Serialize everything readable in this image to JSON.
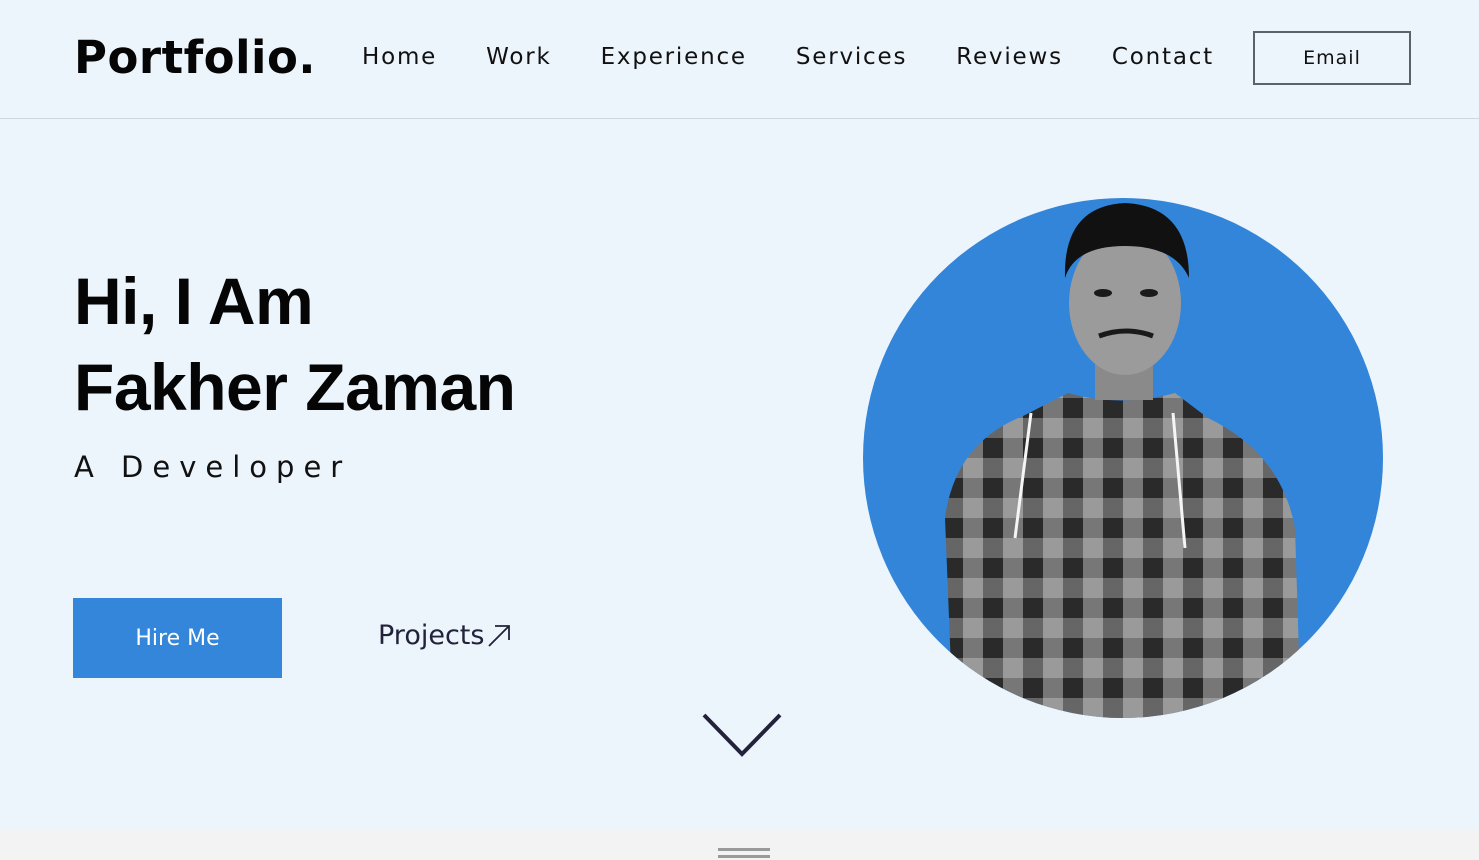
{
  "header": {
    "logo": "Portfolio.",
    "nav": [
      "Home",
      "Work",
      "Experience",
      "Services",
      "Reviews",
      "Contact"
    ],
    "email_label": "Email"
  },
  "hero": {
    "greeting": "Hi, I Am",
    "name": "Fakher Zaman",
    "role": "A Developer",
    "hire_label": "Hire Me",
    "projects_label": "Projects"
  },
  "profile": {
    "icon": "profile-photo",
    "circle_color": "#3385d9"
  },
  "colors": {
    "background": "#ecf4fc",
    "accent": "#3386d9",
    "text_dark": "#0c0c0c",
    "link_dark": "#22223a",
    "bottom_strip": "#f3f3f3"
  },
  "icons": {
    "projects": "arrow-up-right-icon",
    "scroll": "chevron-down-icon",
    "handle": "drag-handle-icon"
  }
}
